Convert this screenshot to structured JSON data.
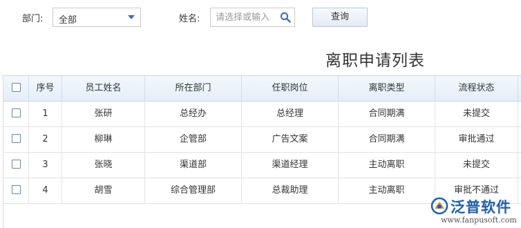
{
  "filters": {
    "department_label": "部门:",
    "department_value": "全部",
    "name_label": "姓名:",
    "name_placeholder": "请选择或输入",
    "query_button": "查询"
  },
  "page_title": "离职申请列表",
  "table": {
    "columns": [
      "序号",
      "员工姓名",
      "所在部门",
      "任职岗位",
      "离职类型",
      "流程状态"
    ],
    "rows": [
      {
        "no": "1",
        "name": "张研",
        "dept": "总经办",
        "position": "总经理",
        "type": "合同期满",
        "status": "未提交"
      },
      {
        "no": "2",
        "name": "柳琳",
        "dept": "企管部",
        "position": "广告文案",
        "type": "合同期满",
        "status": "审批通过"
      },
      {
        "no": "3",
        "name": "张晓",
        "dept": "渠道部",
        "position": "渠道经理",
        "type": "主动离职",
        "status": "未提交"
      },
      {
        "no": "4",
        "name": "胡雪",
        "dept": "综合管理部",
        "position": "总裁助理",
        "type": "主动离职",
        "status": "审批不通过"
      }
    ]
  },
  "watermark": {
    "brand": "泛普软件",
    "url": "www.fanpusoft.com"
  },
  "colors": {
    "accent": "#3d6fb0",
    "header_bg": "#e5eef8",
    "brand": "#1d5fa8"
  }
}
